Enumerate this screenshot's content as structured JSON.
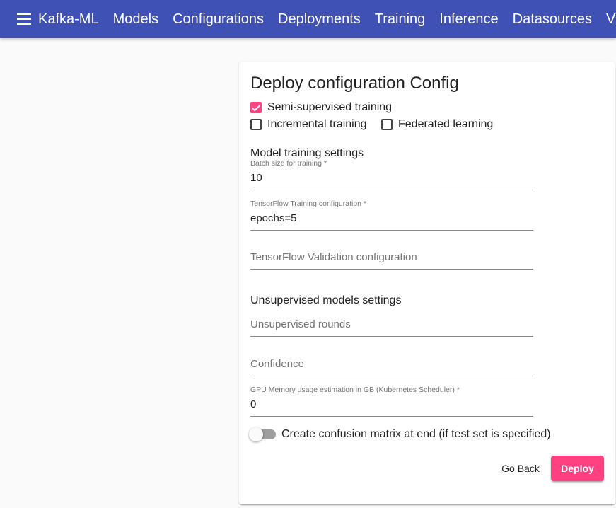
{
  "header": {
    "brand": "Kafka-ML",
    "nav": [
      "Models",
      "Configurations",
      "Deployments",
      "Training",
      "Inference",
      "Datasources"
    ],
    "nav_partial": "V"
  },
  "form": {
    "title": "Deploy configuration Config",
    "checkboxes": {
      "semi_supervised": {
        "label": "Semi-supervised training",
        "checked": true
      },
      "incremental": {
        "label": "Incremental training",
        "checked": false
      },
      "federated": {
        "label": "Federated learning",
        "checked": false
      }
    },
    "model_training_heading": "Model training settings",
    "batch_size": {
      "label": "Batch size for training *",
      "value": "10"
    },
    "tf_training": {
      "label": "TensorFlow Training configuration *",
      "value": "epochs=5"
    },
    "tf_validation": {
      "placeholder": "TensorFlow Validation configuration",
      "value": ""
    },
    "unsupervised_heading": "Unsupervised models settings",
    "unsupervised_rounds": {
      "placeholder": "Unsupervised rounds",
      "value": ""
    },
    "confidence": {
      "placeholder": "Confidence",
      "value": ""
    },
    "gpu_memory": {
      "label": "GPU Memory usage estimation in GB (Kubernetes Scheduler) *",
      "value": "0"
    },
    "confusion_matrix": {
      "label": "Create confusion matrix at end (if test set is specified)",
      "on": false
    },
    "buttons": {
      "back": "Go Back",
      "deploy": "Deploy"
    }
  },
  "colors": {
    "primary": "#3f51b5",
    "accent": "#ff4081"
  }
}
